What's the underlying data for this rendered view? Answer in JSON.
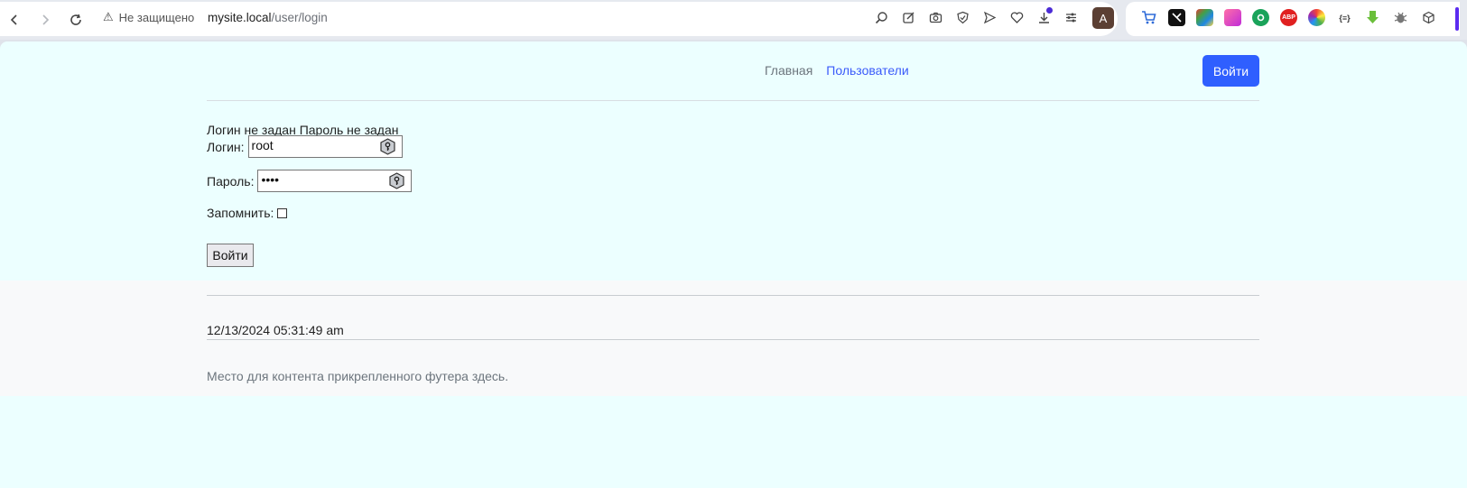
{
  "browser": {
    "security_label": "Не защищено",
    "url_host": "mysite.local",
    "url_path": "/user/login",
    "avatar_letter": "A"
  },
  "header": {
    "nav_home": "Главная",
    "nav_users": "Пользователи",
    "login_button": "Войти"
  },
  "form": {
    "errors": "Логин не задан Пароль не задан",
    "login_label": "Логин:",
    "login_value": "root",
    "password_label": "Пароль:",
    "password_value": "••••",
    "remember_label": "Запомнить:",
    "remember_checked": false,
    "submit_label": "Войти"
  },
  "footer": {
    "timestamp": "12/13/2024 05:31:49 am",
    "text": "Место для контента прикрепленного футера здесь."
  },
  "colors": {
    "page_bg": "#ecffff",
    "primary": "#2f5fff",
    "link": "#3b5bfa"
  }
}
